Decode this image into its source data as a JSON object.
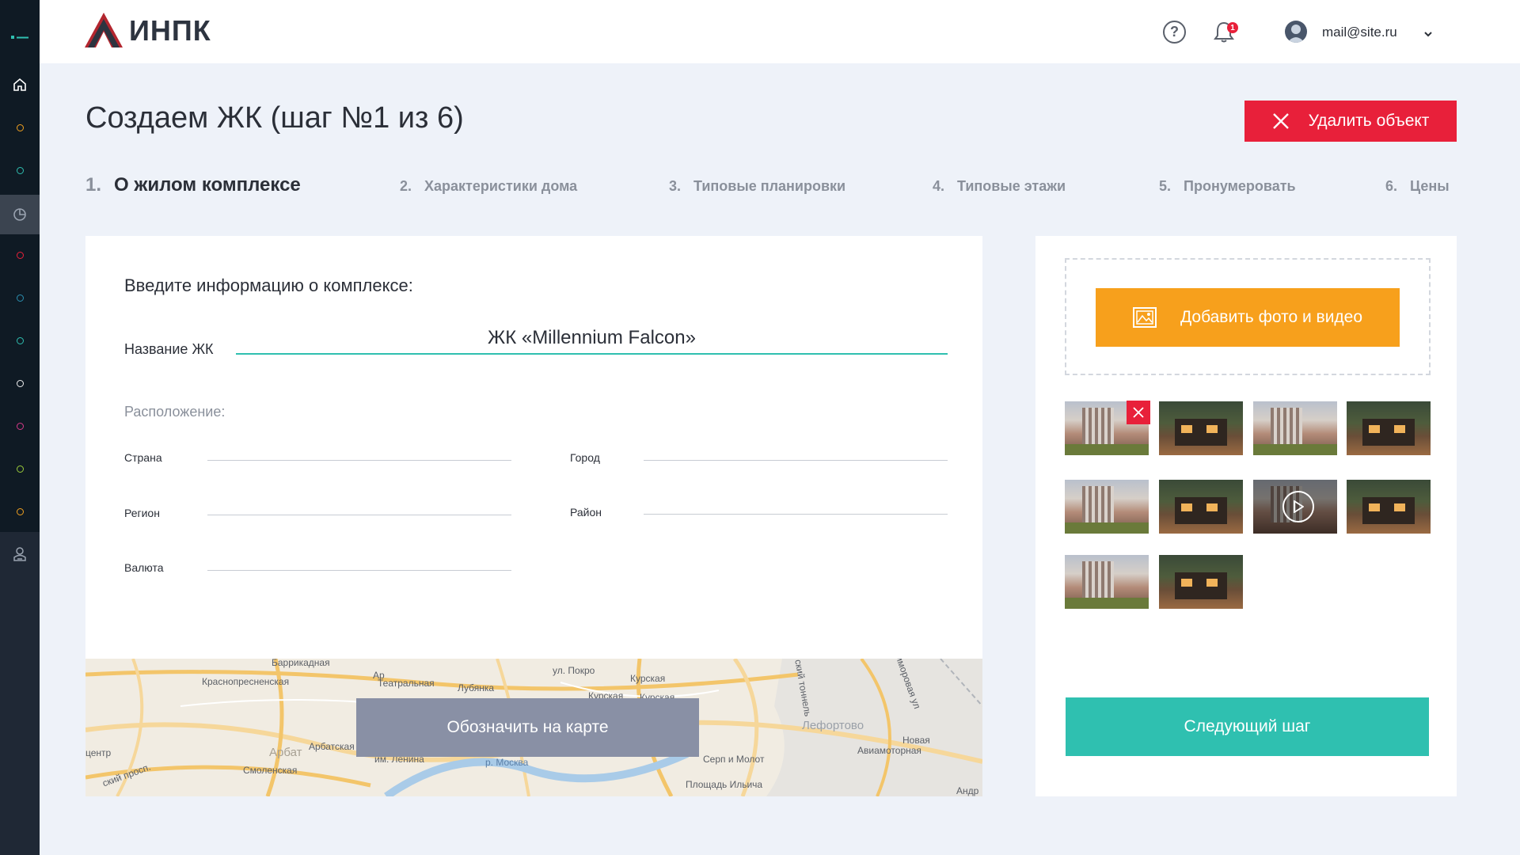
{
  "header": {
    "logo_text": "ИНПК",
    "user_email": "mail@site.ru",
    "notification_count": "1",
    "help_glyph": "?"
  },
  "sidebar": {
    "items": [
      {
        "icon": "home-icon"
      },
      {
        "icon": "circle-icon",
        "color": "#f0a020"
      },
      {
        "icon": "circle-icon",
        "color": "#2fbfb0"
      },
      {
        "icon": "pie-chart-icon"
      },
      {
        "icon": "circle-icon",
        "color": "#e8203a"
      },
      {
        "icon": "circle-icon",
        "color": "#2b8fb0"
      },
      {
        "icon": "circle-icon",
        "color": "#2fbfb0"
      },
      {
        "icon": "circle-icon",
        "color": "#f0f0f0"
      },
      {
        "icon": "circle-icon",
        "color": "#d63a8a"
      },
      {
        "icon": "circle-icon",
        "color": "#9acb3a"
      },
      {
        "icon": "circle-icon",
        "color": "#f0a020"
      },
      {
        "icon": "user-badge-icon"
      }
    ]
  },
  "page": {
    "title": "Создаем ЖК (шаг №1 из 6)",
    "delete_label": "Удалить объект"
  },
  "steps": [
    {
      "num": "1.",
      "label": "О жилом комплексе",
      "active": true
    },
    {
      "num": "2.",
      "label": "Характеристики дома",
      "active": false
    },
    {
      "num": "3.",
      "label": "Типовые планировки",
      "active": false
    },
    {
      "num": "4.",
      "label": "Типовые этажи",
      "active": false
    },
    {
      "num": "5.",
      "label": "Пронумеровать",
      "active": false
    },
    {
      "num": "6.",
      "label": "Цены",
      "active": false
    }
  ],
  "form": {
    "heading": "Введите информацию о комплексе:",
    "name_label": "Название ЖК",
    "name_value": "ЖК «Millennium Falcon»",
    "location_label": "Расположение:",
    "country_label": "Страна",
    "city_label": "Город",
    "region_label": "Регион",
    "district_label": "Район",
    "currency_label": "Валюта"
  },
  "map": {
    "button_label": "Обозначить на карте",
    "labels": {
      "l1": "Баррикадная",
      "l2": "Краснопресненская",
      "l3": "Театральная",
      "l4": "Лубянка",
      "l5": "ул. Покро",
      "l6": "Курская",
      "l7": "Курская",
      "l8": "Курская",
      "l9": "ский тоннель",
      "l10": "Лефортово",
      "l11": "Гиморовая ул",
      "l12": "Арбат",
      "l13": "Арбатская",
      "l14": "центр",
      "l15": "им. Ленина",
      "l16": "р. Москва",
      "l17": "Серп и Молот",
      "l18": "Авиамоторная",
      "l19": "Новая",
      "l20": "Смоленская",
      "l21": "ский просп.",
      "l22": "Площадь Ильича",
      "l23": "Андр",
      "l24": "Ар"
    }
  },
  "media": {
    "add_label": "Добавить фото и видео",
    "next_label": "Следующий шаг",
    "thumbnails": [
      {
        "type": "building"
      },
      {
        "type": "house"
      },
      {
        "type": "building"
      },
      {
        "type": "house"
      },
      {
        "type": "building"
      },
      {
        "type": "house"
      },
      {
        "type": "video"
      },
      {
        "type": "house"
      },
      {
        "type": "building"
      },
      {
        "type": "house"
      }
    ]
  }
}
